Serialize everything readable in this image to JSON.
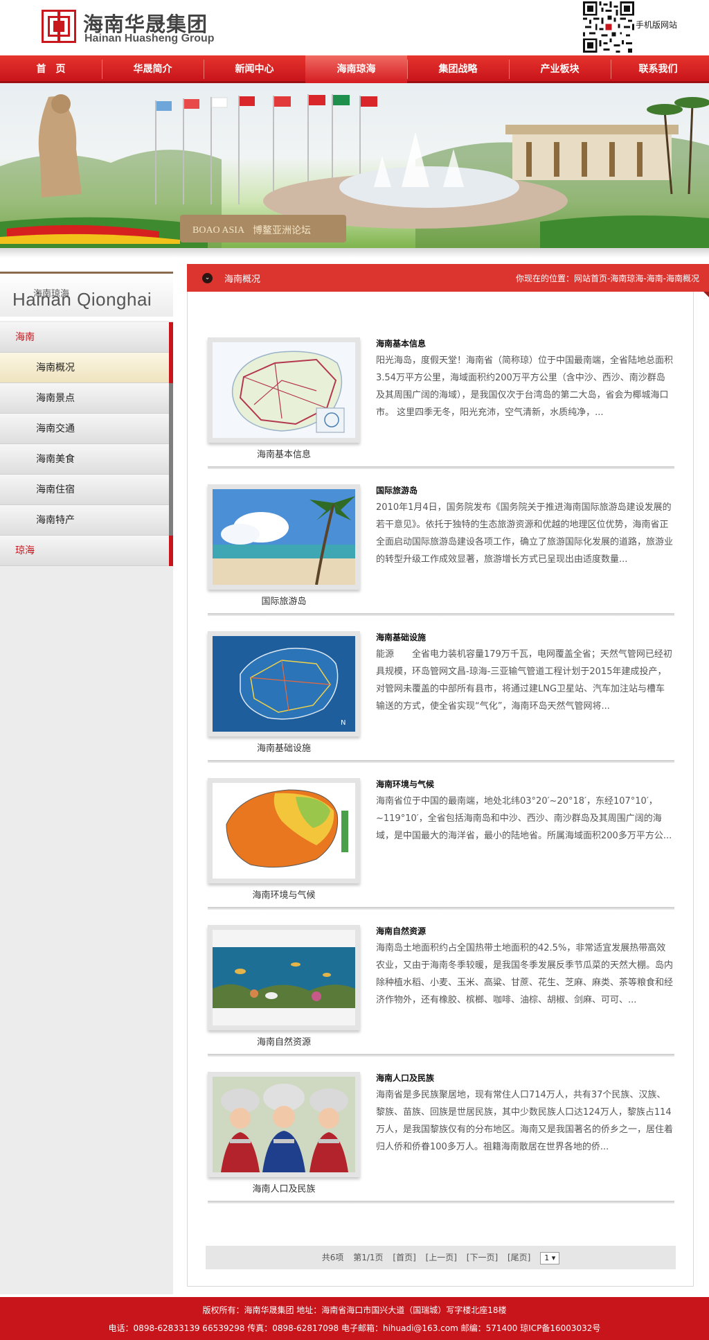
{
  "header": {
    "logo_cn": "海南华晟集团",
    "logo_en": "Hainan Huasheng Group",
    "qr_label": "手机版网站"
  },
  "nav": {
    "items": [
      "首　页",
      "华晟简介",
      "新闻中心",
      "海南琼海",
      "集团战略",
      "产业板块",
      "联系我们"
    ],
    "active_index": 3
  },
  "banner": {
    "sign_text": "博鳌亚洲论坛",
    "sign_en": "BOAO ASIA"
  },
  "sidebar": {
    "title_cn": "海南琼海",
    "title_en": "Hainan Qionghai",
    "items": [
      {
        "label": "海南",
        "type": "category"
      },
      {
        "label": "海南概况",
        "type": "sub",
        "active": true
      },
      {
        "label": "海南景点",
        "type": "sub"
      },
      {
        "label": "海南交通",
        "type": "sub"
      },
      {
        "label": "海南美食",
        "type": "sub"
      },
      {
        "label": "海南住宿",
        "type": "sub"
      },
      {
        "label": "海南特产",
        "type": "sub"
      },
      {
        "label": "琼海",
        "type": "category"
      }
    ]
  },
  "main": {
    "title": "海南概况",
    "breadcrumb": "你现在的位置：网站首页-海南琼海-海南-海南概况",
    "articles": [
      {
        "title": "海南基本信息",
        "caption": "海南基本信息",
        "thumb": "map-icon",
        "desc": "阳光海岛，度假天堂！海南省（简称琼）位于中国最南端，全省陆地总面积3.54万平方公里，海域面积约200万平方公里（含中沙、西沙、南沙群岛及其周围广阔的海域），是我国仅次于台湾岛的第二大岛，省会为椰城海口市。 这里四季无冬，阳光充沛，空气清新，水质纯净，..."
      },
      {
        "title": "国际旅游岛",
        "caption": "国际旅游岛",
        "thumb": "beach-icon",
        "desc": "2010年1月4日，国务院发布《国务院关于推进海南国际旅游岛建设发展的若干意见》。依托于独特的生态旅游资源和优越的地理区位优势，海南省正全面启动国际旅游岛建设各项工作，确立了旅游国际化发展的道路，旅游业的转型升级工作成效显著，旅游增长方式已呈现出由适度数量..."
      },
      {
        "title": "海南基础设施",
        "caption": "海南基础设施",
        "thumb": "infrastructure-map-icon",
        "desc": "能源　　全省电力装机容量179万千瓦，电网覆盖全省；天然气管网已经初具规模，环岛管网文昌-琼海-三亚输气管道工程计划于2015年建成投产，对管网未覆盖的中部所有县市，将通过建LNG卫星站、汽车加注站与槽车输送的方式，使全省实现“气化”，海南环岛天然气管网将..."
      },
      {
        "title": "海南环境与气候",
        "caption": "海南环境与气候",
        "thumb": "climate-map-icon",
        "desc": "海南省位于中国的最南端，地处北纬03°20′~20°18′，东经107°10′，~119°10′，全省包括海南岛和中沙、西沙、南沙群岛及其周围广阔的海域，是中国最大的海洋省，最小的陆地省。所属海域面积200多万平方公..."
      },
      {
        "title": "海南自然资源",
        "caption": "海南自然资源",
        "thumb": "coral-reef-icon",
        "desc": "海南岛土地面积约占全国热带土地面积的42.5%，非常适宜发展热带高效农业，又由于海南冬季较暖，是我国冬季发展反季节瓜菜的天然大棚。岛内除种植水稻、小麦、玉米、高粱、甘蔗、花生、芝麻、麻类、茶等粮食和经济作物外，还有橡胶、槟榔、咖啡、油棕、胡椒、剑麻、可可、..."
      },
      {
        "title": "海南人口及民族",
        "caption": "海南人口及民族",
        "thumb": "ethnic-people-icon",
        "desc": "海南省是多民族聚居地，现有常住人口714万人，共有37个民族、汉族、黎族、苗族、回族是世居民族，其中少数民族人口达124万人，黎族占114万人，是我国黎族仅有的分布地区。海南又是我国著名的侨乡之一，居住着归人侨和侨眷100多万人。祖籍海南散居在世界各地的侨..."
      }
    ],
    "pager": {
      "total": "共6项",
      "page_info": "第1/1页",
      "first": "[首页]",
      "prev": "[上一页]",
      "next": "[下一页]",
      "last": "[尾页]",
      "select_value": "1 ▾"
    }
  },
  "footer": {
    "line1": "版权所有：海南华晟集团 地址：海南省海口市国兴大道（国瑞城）写字楼北座18楼",
    "line2": "电话：0898-62833139 66539298 传真：0898-62817098 电子邮箱：hihuadi@163.com 邮编：571400 琼ICP备16003032号"
  },
  "colors": {
    "brand_red": "#c8141b",
    "header_red": "#dc3530"
  }
}
